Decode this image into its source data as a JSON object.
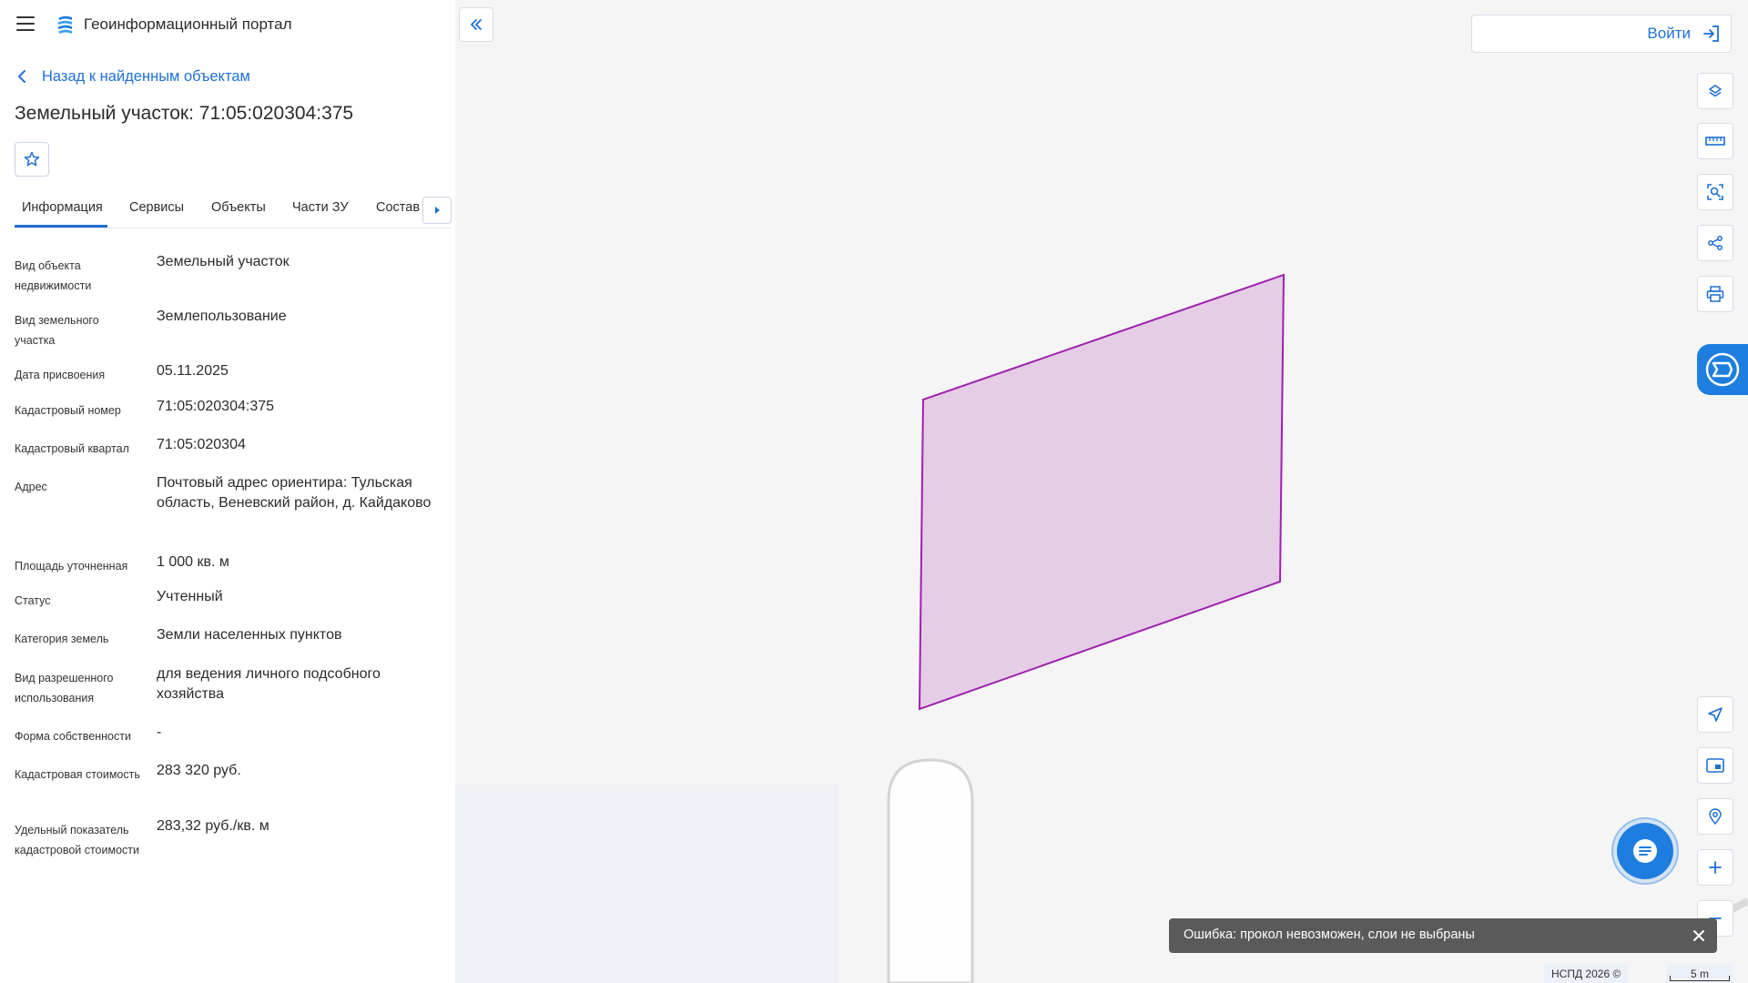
{
  "app": {
    "title": "Геоинформационный портал"
  },
  "nav": {
    "back_label": "Назад к найденным объектам"
  },
  "object": {
    "title": "Земельный участок: 71:05:020304:375"
  },
  "tabs": [
    {
      "label": "Информация",
      "active": true
    },
    {
      "label": "Сервисы"
    },
    {
      "label": "Объекты"
    },
    {
      "label": "Части ЗУ"
    },
    {
      "label": "Состав"
    }
  ],
  "properties": [
    {
      "key": "Вид объекта недвижимости",
      "value": "Земельный участок"
    },
    {
      "key": "Вид земельного участка",
      "value": "Землепользование"
    },
    {
      "key": "Дата присвоения",
      "value": "05.11.2025"
    },
    {
      "key": "Кадастровый номер",
      "value": "71:05:020304:375"
    },
    {
      "key": "Кадастровый квартал",
      "value": "71:05:020304"
    },
    {
      "key": "Адрес",
      "value": "Почтовый адрес ориентира: Тульская область, Веневский район, д. Кайдаково"
    },
    {
      "key": "Площадь уточненная",
      "value": "1 000 кв. м"
    },
    {
      "key": "Статус",
      "value": "Учтенный"
    },
    {
      "key": "Категория земель",
      "value": "Земли населенных пунктов"
    },
    {
      "key": "Вид разрешенного использования",
      "value": "для ведения личного подсобного хозяйства"
    },
    {
      "key": "Форма собственности",
      "value": "-"
    },
    {
      "key": "Кадастровая стоимость",
      "value": "283 320 руб."
    },
    {
      "key": "Удельный показатель кадастровой стоимости",
      "value": "283,32 руб./кв. м"
    }
  ],
  "header": {
    "login_label": "Войти"
  },
  "toast": {
    "message": "Ошибка: прокол невозможен, слои не выбраны"
  },
  "map": {
    "attribution": "НСПД 2026 ©",
    "scale_label": "5 m",
    "parcel_fill": "#e6cde6",
    "parcel_stroke": "#a020b0"
  },
  "colors": {
    "accent": "#1e6fd6",
    "assistant": "#1e7ee0"
  },
  "icons": [
    "menu-icon",
    "logo-icon",
    "chevron-left-icon",
    "star-icon",
    "chevron-right-icon",
    "double-chevron-left-icon",
    "login-icon",
    "layers-icon",
    "ruler-icon",
    "select-area-icon",
    "share-icon",
    "print-icon",
    "assistant-icon",
    "navigate-icon",
    "minimap-icon",
    "location-search-icon",
    "zoom-in-icon",
    "zoom-out-icon",
    "chat-icon",
    "close-icon"
  ]
}
